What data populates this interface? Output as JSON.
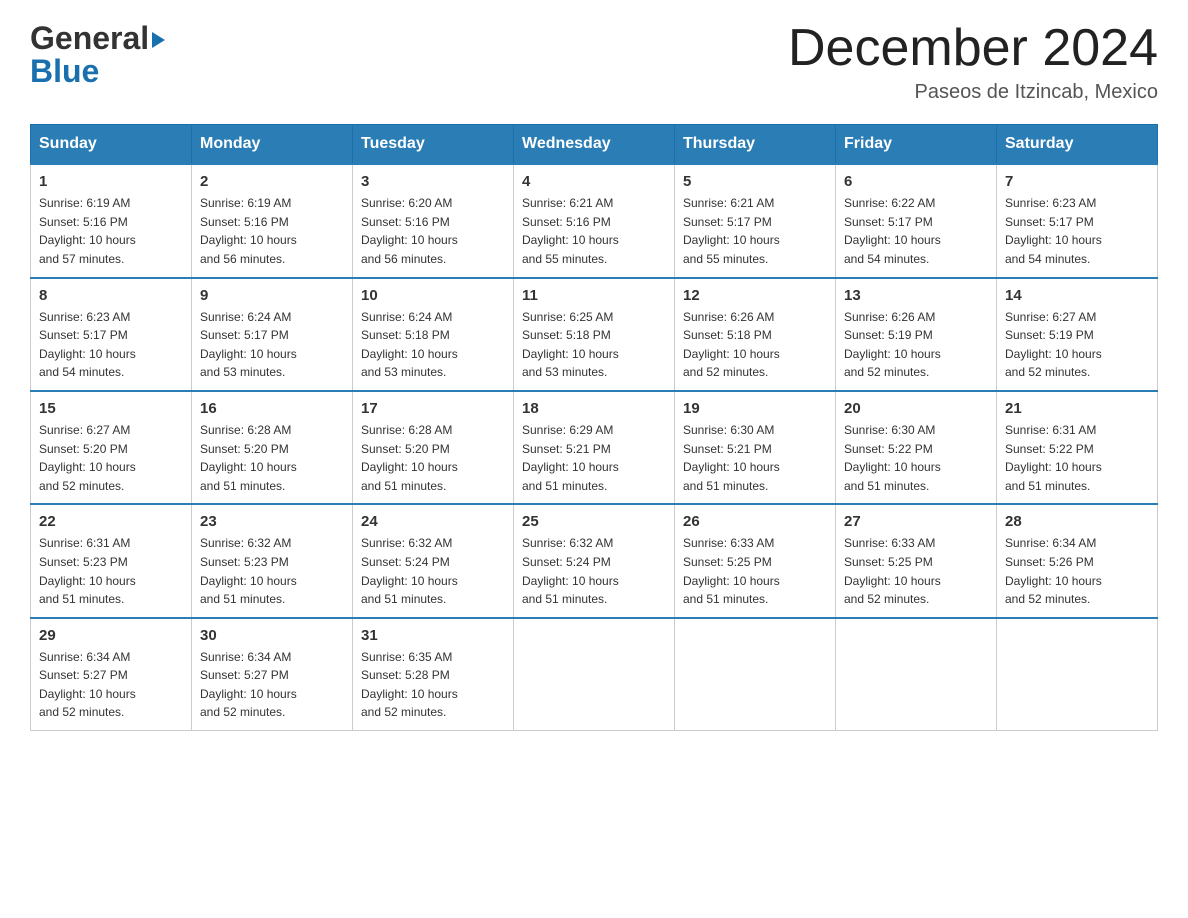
{
  "logo": {
    "general": "General",
    "blue": "Blue",
    "triangle_char": "▶"
  },
  "header": {
    "month_year": "December 2024",
    "location": "Paseos de Itzincab, Mexico"
  },
  "days_of_week": [
    "Sunday",
    "Monday",
    "Tuesday",
    "Wednesday",
    "Thursday",
    "Friday",
    "Saturday"
  ],
  "weeks": [
    [
      {
        "day": "1",
        "sunrise": "6:19 AM",
        "sunset": "5:16 PM",
        "daylight": "10 hours and 57 minutes."
      },
      {
        "day": "2",
        "sunrise": "6:19 AM",
        "sunset": "5:16 PM",
        "daylight": "10 hours and 56 minutes."
      },
      {
        "day": "3",
        "sunrise": "6:20 AM",
        "sunset": "5:16 PM",
        "daylight": "10 hours and 56 minutes."
      },
      {
        "day": "4",
        "sunrise": "6:21 AM",
        "sunset": "5:16 PM",
        "daylight": "10 hours and 55 minutes."
      },
      {
        "day": "5",
        "sunrise": "6:21 AM",
        "sunset": "5:17 PM",
        "daylight": "10 hours and 55 minutes."
      },
      {
        "day": "6",
        "sunrise": "6:22 AM",
        "sunset": "5:17 PM",
        "daylight": "10 hours and 54 minutes."
      },
      {
        "day": "7",
        "sunrise": "6:23 AM",
        "sunset": "5:17 PM",
        "daylight": "10 hours and 54 minutes."
      }
    ],
    [
      {
        "day": "8",
        "sunrise": "6:23 AM",
        "sunset": "5:17 PM",
        "daylight": "10 hours and 54 minutes."
      },
      {
        "day": "9",
        "sunrise": "6:24 AM",
        "sunset": "5:17 PM",
        "daylight": "10 hours and 53 minutes."
      },
      {
        "day": "10",
        "sunrise": "6:24 AM",
        "sunset": "5:18 PM",
        "daylight": "10 hours and 53 minutes."
      },
      {
        "day": "11",
        "sunrise": "6:25 AM",
        "sunset": "5:18 PM",
        "daylight": "10 hours and 53 minutes."
      },
      {
        "day": "12",
        "sunrise": "6:26 AM",
        "sunset": "5:18 PM",
        "daylight": "10 hours and 52 minutes."
      },
      {
        "day": "13",
        "sunrise": "6:26 AM",
        "sunset": "5:19 PM",
        "daylight": "10 hours and 52 minutes."
      },
      {
        "day": "14",
        "sunrise": "6:27 AM",
        "sunset": "5:19 PM",
        "daylight": "10 hours and 52 minutes."
      }
    ],
    [
      {
        "day": "15",
        "sunrise": "6:27 AM",
        "sunset": "5:20 PM",
        "daylight": "10 hours and 52 minutes."
      },
      {
        "day": "16",
        "sunrise": "6:28 AM",
        "sunset": "5:20 PM",
        "daylight": "10 hours and 51 minutes."
      },
      {
        "day": "17",
        "sunrise": "6:28 AM",
        "sunset": "5:20 PM",
        "daylight": "10 hours and 51 minutes."
      },
      {
        "day": "18",
        "sunrise": "6:29 AM",
        "sunset": "5:21 PM",
        "daylight": "10 hours and 51 minutes."
      },
      {
        "day": "19",
        "sunrise": "6:30 AM",
        "sunset": "5:21 PM",
        "daylight": "10 hours and 51 minutes."
      },
      {
        "day": "20",
        "sunrise": "6:30 AM",
        "sunset": "5:22 PM",
        "daylight": "10 hours and 51 minutes."
      },
      {
        "day": "21",
        "sunrise": "6:31 AM",
        "sunset": "5:22 PM",
        "daylight": "10 hours and 51 minutes."
      }
    ],
    [
      {
        "day": "22",
        "sunrise": "6:31 AM",
        "sunset": "5:23 PM",
        "daylight": "10 hours and 51 minutes."
      },
      {
        "day": "23",
        "sunrise": "6:32 AM",
        "sunset": "5:23 PM",
        "daylight": "10 hours and 51 minutes."
      },
      {
        "day": "24",
        "sunrise": "6:32 AM",
        "sunset": "5:24 PM",
        "daylight": "10 hours and 51 minutes."
      },
      {
        "day": "25",
        "sunrise": "6:32 AM",
        "sunset": "5:24 PM",
        "daylight": "10 hours and 51 minutes."
      },
      {
        "day": "26",
        "sunrise": "6:33 AM",
        "sunset": "5:25 PM",
        "daylight": "10 hours and 51 minutes."
      },
      {
        "day": "27",
        "sunrise": "6:33 AM",
        "sunset": "5:25 PM",
        "daylight": "10 hours and 52 minutes."
      },
      {
        "day": "28",
        "sunrise": "6:34 AM",
        "sunset": "5:26 PM",
        "daylight": "10 hours and 52 minutes."
      }
    ],
    [
      {
        "day": "29",
        "sunrise": "6:34 AM",
        "sunset": "5:27 PM",
        "daylight": "10 hours and 52 minutes."
      },
      {
        "day": "30",
        "sunrise": "6:34 AM",
        "sunset": "5:27 PM",
        "daylight": "10 hours and 52 minutes."
      },
      {
        "day": "31",
        "sunrise": "6:35 AM",
        "sunset": "5:28 PM",
        "daylight": "10 hours and 52 minutes."
      },
      null,
      null,
      null,
      null
    ]
  ],
  "labels": {
    "sunrise": "Sunrise:",
    "sunset": "Sunset:",
    "daylight": "Daylight:"
  },
  "colors": {
    "header_bg": "#2a7db5",
    "border": "#1a6faf",
    "logo_blue": "#1a6faf"
  }
}
